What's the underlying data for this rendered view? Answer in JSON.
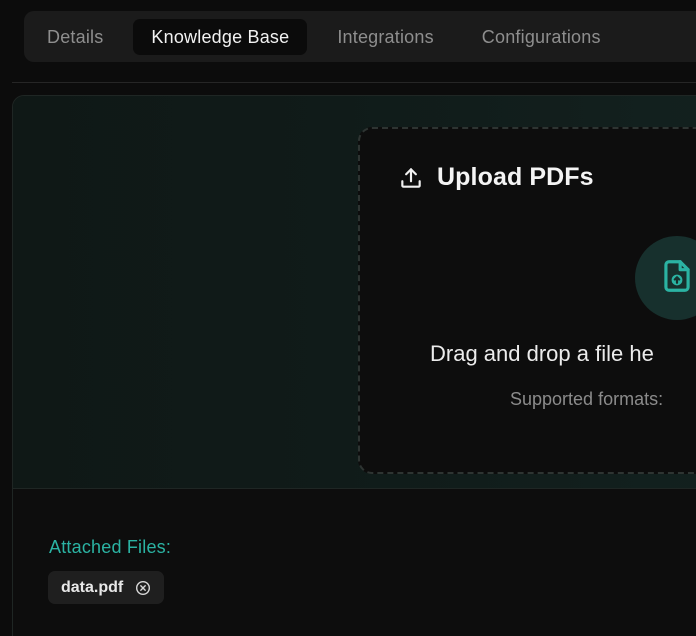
{
  "tabs": [
    {
      "label": "Details",
      "active": false
    },
    {
      "label": "Knowledge Base",
      "active": true
    },
    {
      "label": "Integrations",
      "active": false
    },
    {
      "label": "Configurations",
      "active": false
    }
  ],
  "upload": {
    "title": "Upload PDFs",
    "drop_text": "Drag and drop a file he",
    "formats_text": "Supported formats:",
    "header_icon": "upload-icon",
    "center_icon": "file-upload-icon"
  },
  "attached": {
    "label": "Attached Files:",
    "files": [
      {
        "name": "data.pdf",
        "remove_icon": "remove-circle-icon"
      }
    ]
  },
  "colors": {
    "accent": "#2bb3a3",
    "background": "#0c0c0c",
    "tab_bar": "#1b1b1b",
    "chip": "#1f1f1f"
  }
}
